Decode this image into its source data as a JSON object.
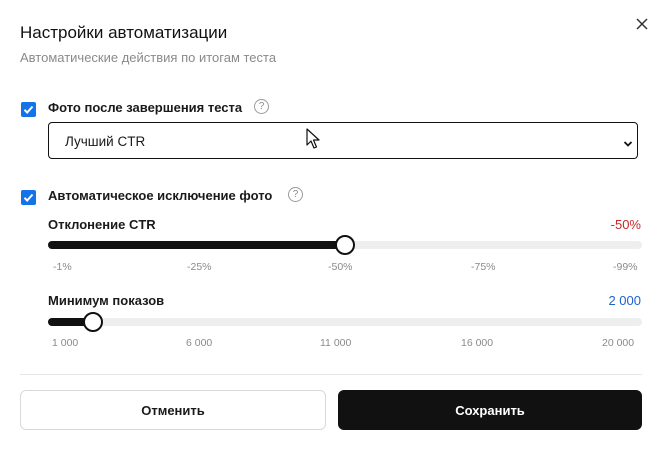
{
  "dialog": {
    "title": "Настройки автоматизации",
    "subtitle": "Автоматические действия по итогам теста",
    "close_icon": "close-icon"
  },
  "photo_after_test": {
    "checked": true,
    "label": "Фото после завершения теста",
    "help_icon": "help-icon",
    "select_value": "Лучший CTR"
  },
  "auto_exclude": {
    "checked": true,
    "label": "Автоматическое исключение фото",
    "help_icon": "help-icon"
  },
  "ctr_deviation": {
    "label": "Отклонение CTR",
    "value_text": "-50%",
    "value_color": "#c62828",
    "level_fraction": 0.5,
    "ticks": [
      "-1%",
      "-25%",
      "-50%",
      "-75%",
      "-99%"
    ]
  },
  "min_impressions": {
    "label": "Минимум показов",
    "value_text": "2 000",
    "value_color": "#1e63c8",
    "value": 2000,
    "ticks": [
      "1 000",
      "6 000",
      "11 000",
      "16 000",
      "20 000"
    ]
  },
  "buttons": {
    "cancel": "Отменить",
    "save": "Сохранить"
  },
  "colors": {
    "checkbox": "#1473e6",
    "primary": "#111111"
  }
}
